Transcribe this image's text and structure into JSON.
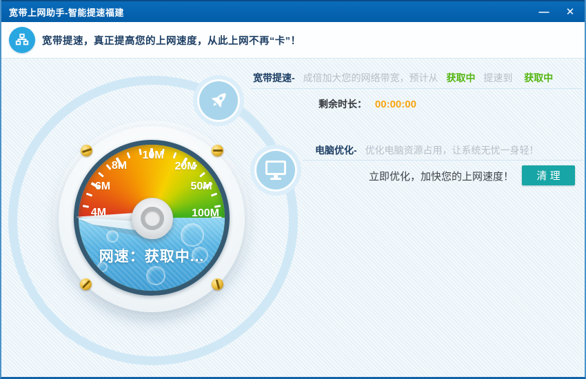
{
  "window": {
    "title": "宽带上网助手-智能提速福建",
    "minimize_glyph": "—",
    "close_glyph": "✕"
  },
  "header": {
    "message": "宽带提速，真正提高您的上网速度，从此上网不再“卡”！",
    "icon": "network-nodes-icon"
  },
  "gauge": {
    "tick_labels": [
      "4M",
      "6M",
      "8M",
      "10M",
      "20M",
      "50M",
      "100M"
    ],
    "status_text": "网速：获取中...",
    "needle_points_to": "4M",
    "icons": [
      "rocket-icon",
      "monitor-icon"
    ]
  },
  "speedup": {
    "title": "宽带提速-",
    "desc_prefix": "成倍加大您的网络带宽，预计从",
    "from_value": "获取中",
    "middle": "提速到",
    "to_value": "获取中",
    "remaining_label": "剩余时长：",
    "remaining_time": "00:00:00"
  },
  "optimize": {
    "title": "电脑优化-",
    "desc": "优化电脑资源占用，让系统无忧一身轻！",
    "action_text": "立即优化，加快您的上网速度！",
    "clean_button": "清 理"
  },
  "colors": {
    "titlebar_blue": "#0663b0",
    "header_icon_blue": "#29a7e1",
    "accent_green": "#54b510",
    "time_orange": "#f8a410",
    "clean_teal": "#18a5a5",
    "water_blue": "#4aa9de",
    "ring_blue": "#d0e8f6"
  }
}
